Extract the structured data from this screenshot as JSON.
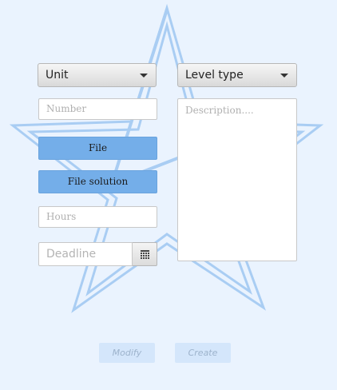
{
  "form": {
    "unit_combo": {
      "value": "Unit"
    },
    "level_combo": {
      "value": "Level type"
    },
    "number_field": {
      "placeholder": "Number"
    },
    "description_field": {
      "placeholder": "Description...."
    },
    "file_button": {
      "label": "File"
    },
    "file_solution_button": {
      "label": "File solution"
    },
    "hours_field": {
      "placeholder": "Hours"
    },
    "deadline_field": {
      "placeholder": "Deadline"
    },
    "calendar_icon": {
      "icon": "calendar-icon"
    }
  },
  "actions": {
    "modify_label": "Modify",
    "create_label": "Create"
  },
  "background": {
    "icon": "star-watermark-icon",
    "color": "#eaf3fe",
    "star_color": "#a9cdf3"
  },
  "colors": {
    "button_blue": "#74aee9",
    "disabled_button": "#d4e6fb"
  }
}
